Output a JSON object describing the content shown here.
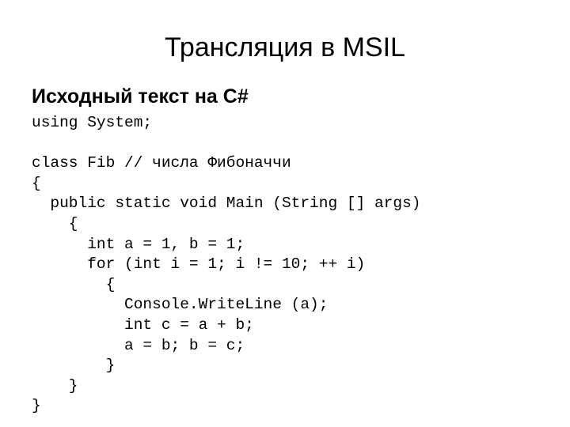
{
  "slide": {
    "title": "Трансляция в MSIL",
    "subtitle": "Исходный текст на C#",
    "background_color": "#ffffff",
    "text_color": "#000000"
  },
  "code": {
    "language": "C#",
    "lines": [
      "using System;",
      "",
      "class Fib // числа Фибоначчи",
      "{",
      "  public static void Main (String [] args)",
      "    {",
      "      int a = 1, b = 1;",
      "      for (int i = 1; i != 10; ++ i)",
      "        {",
      "          Console.WriteLine (a);",
      "          int c = a + b;",
      "          a = b; b = c;",
      "        }",
      "    }",
      "}"
    ]
  }
}
